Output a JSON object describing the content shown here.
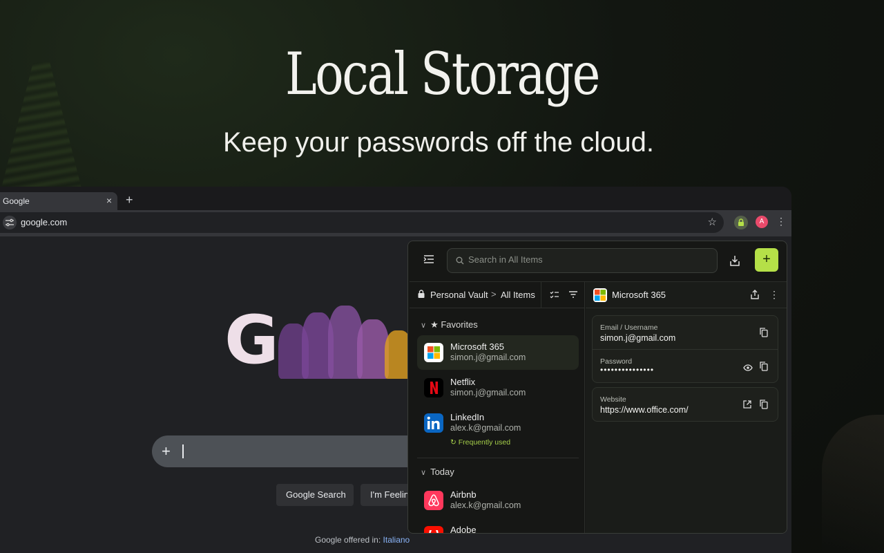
{
  "hero": {
    "title": "Local Storage",
    "subtitle": "Keep your passwords off the cloud."
  },
  "browser": {
    "tab_title": "Google",
    "tab_close": "×",
    "new_tab": "+",
    "url": "google.com",
    "avatar_letter": "A"
  },
  "google": {
    "search_button": "Google Search",
    "lucky_button": "I'm Feeling",
    "offered_in": "Google offered in:",
    "language": "Italiano",
    "plus": "+"
  },
  "popup": {
    "search_placeholder": "Search in All Items",
    "add_label": "+",
    "breadcrumb": {
      "vault": "Personal Vault",
      "separator": ">",
      "scope": "All Items"
    },
    "sections": {
      "favorites": "★ Favorites",
      "today": "Today"
    },
    "items": [
      {
        "name": "Microsoft 365",
        "user": "simon.j@gmail.com",
        "icon": "microsoft-icon"
      },
      {
        "name": "Netflix",
        "user": "simon.j@gmail.com",
        "icon": "netflix-icon"
      },
      {
        "name": "LinkedIn",
        "user": "alex.k@gmail.com",
        "icon": "linkedin-icon",
        "tag": "Frequently used"
      },
      {
        "name": "Airbnb",
        "user": "alex.k@gmail.com",
        "icon": "airbnb-icon"
      },
      {
        "name": "Adobe",
        "user": "",
        "icon": "adobe-icon"
      }
    ],
    "detail": {
      "title": "Microsoft 365",
      "fields": [
        {
          "label": "Email / Username",
          "value": "simon.j@gmail.com"
        },
        {
          "label": "Password",
          "value": "•••••••••••••••"
        },
        {
          "label": "Website",
          "value": "https://www.office.com/"
        }
      ]
    },
    "colors": {
      "accent": "#b5e048",
      "tag": "#a6cf4a"
    }
  }
}
